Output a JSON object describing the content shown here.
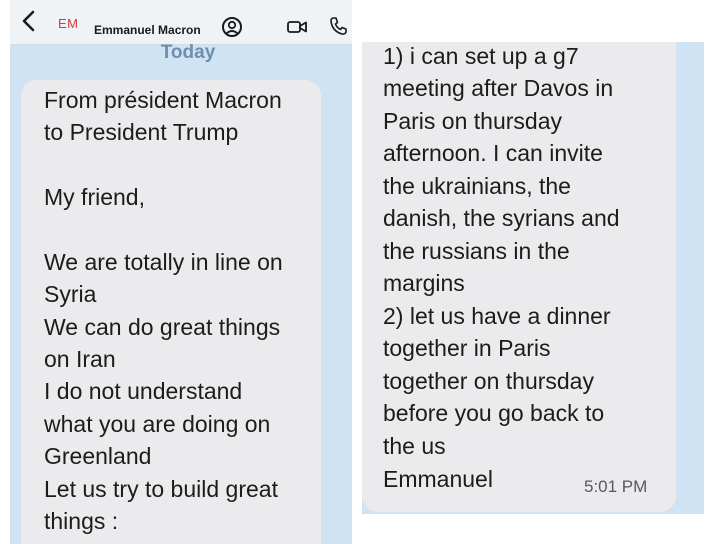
{
  "header": {
    "avatar_initials": "EM",
    "contact_name": "Emmanuel Macron",
    "icons": [
      "back-chevron-icon",
      "profile-icon",
      "video-camera-icon",
      "phone-icon"
    ]
  },
  "date_label": "Today",
  "message_left_lines": [
    "From président Macron",
    "to President Trump",
    "",
    "My friend,",
    "",
    "We are totally in line on",
    "Syria",
    "We can do great things",
    "on Iran",
    "I do not understand",
    "what you are doing on",
    "Greenland",
    "Let us try to build great",
    "things :"
  ],
  "message_right_lines": [
    "1) i can set up a g7",
    "meeting after Davos in",
    "Paris on thursday",
    "afternoon. I can invite",
    "the ukrainians, the",
    "danish, the syrians and",
    "the russians in the",
    "margins",
    "2) let us have a dinner",
    "together in Paris",
    "together on thursday",
    "before you go back to",
    "the us",
    "Emmanuel"
  ],
  "timestamp": "5:01 PM",
  "colors": {
    "panel_background": "#cfe3f3",
    "bubble_background": "#ebebed",
    "avatar_text": "#d23b3b",
    "date_label": "#6f8fae"
  }
}
